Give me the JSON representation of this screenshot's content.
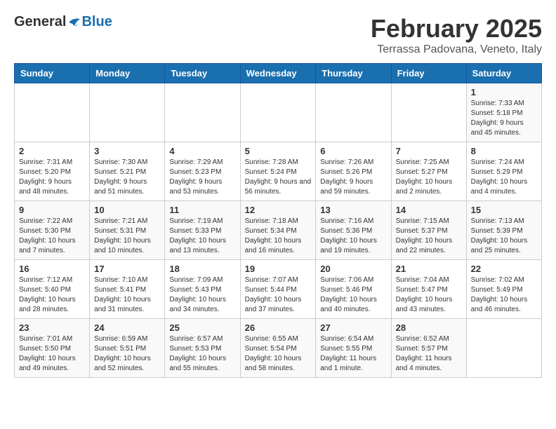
{
  "header": {
    "logo_general": "General",
    "logo_blue": "Blue",
    "month_title": "February 2025",
    "location": "Terrassa Padovana, Veneto, Italy"
  },
  "weekdays": [
    "Sunday",
    "Monday",
    "Tuesday",
    "Wednesday",
    "Thursday",
    "Friday",
    "Saturday"
  ],
  "weeks": [
    [
      {
        "day": "",
        "info": ""
      },
      {
        "day": "",
        "info": ""
      },
      {
        "day": "",
        "info": ""
      },
      {
        "day": "",
        "info": ""
      },
      {
        "day": "",
        "info": ""
      },
      {
        "day": "",
        "info": ""
      },
      {
        "day": "1",
        "info": "Sunrise: 7:33 AM\nSunset: 5:18 PM\nDaylight: 9 hours and 45 minutes."
      }
    ],
    [
      {
        "day": "2",
        "info": "Sunrise: 7:31 AM\nSunset: 5:20 PM\nDaylight: 9 hours and 48 minutes."
      },
      {
        "day": "3",
        "info": "Sunrise: 7:30 AM\nSunset: 5:21 PM\nDaylight: 9 hours and 51 minutes."
      },
      {
        "day": "4",
        "info": "Sunrise: 7:29 AM\nSunset: 5:23 PM\nDaylight: 9 hours and 53 minutes."
      },
      {
        "day": "5",
        "info": "Sunrise: 7:28 AM\nSunset: 5:24 PM\nDaylight: 9 hours and 56 minutes."
      },
      {
        "day": "6",
        "info": "Sunrise: 7:26 AM\nSunset: 5:26 PM\nDaylight: 9 hours and 59 minutes."
      },
      {
        "day": "7",
        "info": "Sunrise: 7:25 AM\nSunset: 5:27 PM\nDaylight: 10 hours and 2 minutes."
      },
      {
        "day": "8",
        "info": "Sunrise: 7:24 AM\nSunset: 5:29 PM\nDaylight: 10 hours and 4 minutes."
      }
    ],
    [
      {
        "day": "9",
        "info": "Sunrise: 7:22 AM\nSunset: 5:30 PM\nDaylight: 10 hours and 7 minutes."
      },
      {
        "day": "10",
        "info": "Sunrise: 7:21 AM\nSunset: 5:31 PM\nDaylight: 10 hours and 10 minutes."
      },
      {
        "day": "11",
        "info": "Sunrise: 7:19 AM\nSunset: 5:33 PM\nDaylight: 10 hours and 13 minutes."
      },
      {
        "day": "12",
        "info": "Sunrise: 7:18 AM\nSunset: 5:34 PM\nDaylight: 10 hours and 16 minutes."
      },
      {
        "day": "13",
        "info": "Sunrise: 7:16 AM\nSunset: 5:36 PM\nDaylight: 10 hours and 19 minutes."
      },
      {
        "day": "14",
        "info": "Sunrise: 7:15 AM\nSunset: 5:37 PM\nDaylight: 10 hours and 22 minutes."
      },
      {
        "day": "15",
        "info": "Sunrise: 7:13 AM\nSunset: 5:39 PM\nDaylight: 10 hours and 25 minutes."
      }
    ],
    [
      {
        "day": "16",
        "info": "Sunrise: 7:12 AM\nSunset: 5:40 PM\nDaylight: 10 hours and 28 minutes."
      },
      {
        "day": "17",
        "info": "Sunrise: 7:10 AM\nSunset: 5:41 PM\nDaylight: 10 hours and 31 minutes."
      },
      {
        "day": "18",
        "info": "Sunrise: 7:09 AM\nSunset: 5:43 PM\nDaylight: 10 hours and 34 minutes."
      },
      {
        "day": "19",
        "info": "Sunrise: 7:07 AM\nSunset: 5:44 PM\nDaylight: 10 hours and 37 minutes."
      },
      {
        "day": "20",
        "info": "Sunrise: 7:06 AM\nSunset: 5:46 PM\nDaylight: 10 hours and 40 minutes."
      },
      {
        "day": "21",
        "info": "Sunrise: 7:04 AM\nSunset: 5:47 PM\nDaylight: 10 hours and 43 minutes."
      },
      {
        "day": "22",
        "info": "Sunrise: 7:02 AM\nSunset: 5:49 PM\nDaylight: 10 hours and 46 minutes."
      }
    ],
    [
      {
        "day": "23",
        "info": "Sunrise: 7:01 AM\nSunset: 5:50 PM\nDaylight: 10 hours and 49 minutes."
      },
      {
        "day": "24",
        "info": "Sunrise: 6:59 AM\nSunset: 5:51 PM\nDaylight: 10 hours and 52 minutes."
      },
      {
        "day": "25",
        "info": "Sunrise: 6:57 AM\nSunset: 5:53 PM\nDaylight: 10 hours and 55 minutes."
      },
      {
        "day": "26",
        "info": "Sunrise: 6:55 AM\nSunset: 5:54 PM\nDaylight: 10 hours and 58 minutes."
      },
      {
        "day": "27",
        "info": "Sunrise: 6:54 AM\nSunset: 5:55 PM\nDaylight: 11 hours and 1 minute."
      },
      {
        "day": "28",
        "info": "Sunrise: 6:52 AM\nSunset: 5:57 PM\nDaylight: 11 hours and 4 minutes."
      },
      {
        "day": "",
        "info": ""
      }
    ]
  ]
}
